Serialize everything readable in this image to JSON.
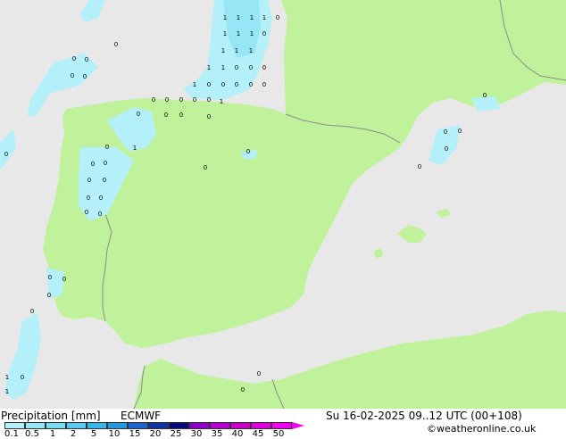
{
  "header": {
    "product_label": "Precipitation [mm]",
    "model_label": "ECMWF",
    "valid_time_label": "Su 16-02-2025 09..12 UTC (00+108)",
    "credit_label": "©weatheronline.co.uk"
  },
  "legend": {
    "ticks": [
      "0.1",
      "0.5",
      "1",
      "2",
      "5",
      "10",
      "15",
      "20",
      "25",
      "30",
      "35",
      "40",
      "45",
      "50"
    ],
    "colors": [
      "#b4f0fa",
      "#96e6f5",
      "#78dcf0",
      "#5ac8f0",
      "#3cb4e6",
      "#2896dc",
      "#1e64c8",
      "#1432a0",
      "#0a0a78",
      "#8c00c8",
      "#b400d2",
      "#c800c8",
      "#dc00dc",
      "#f000f0"
    ]
  },
  "map": {
    "land_color": "#bff29a",
    "sea_color": "#e8e8e8",
    "border_color": "#8c8c8c",
    "point_labels": [
      "1",
      "0"
    ]
  }
}
